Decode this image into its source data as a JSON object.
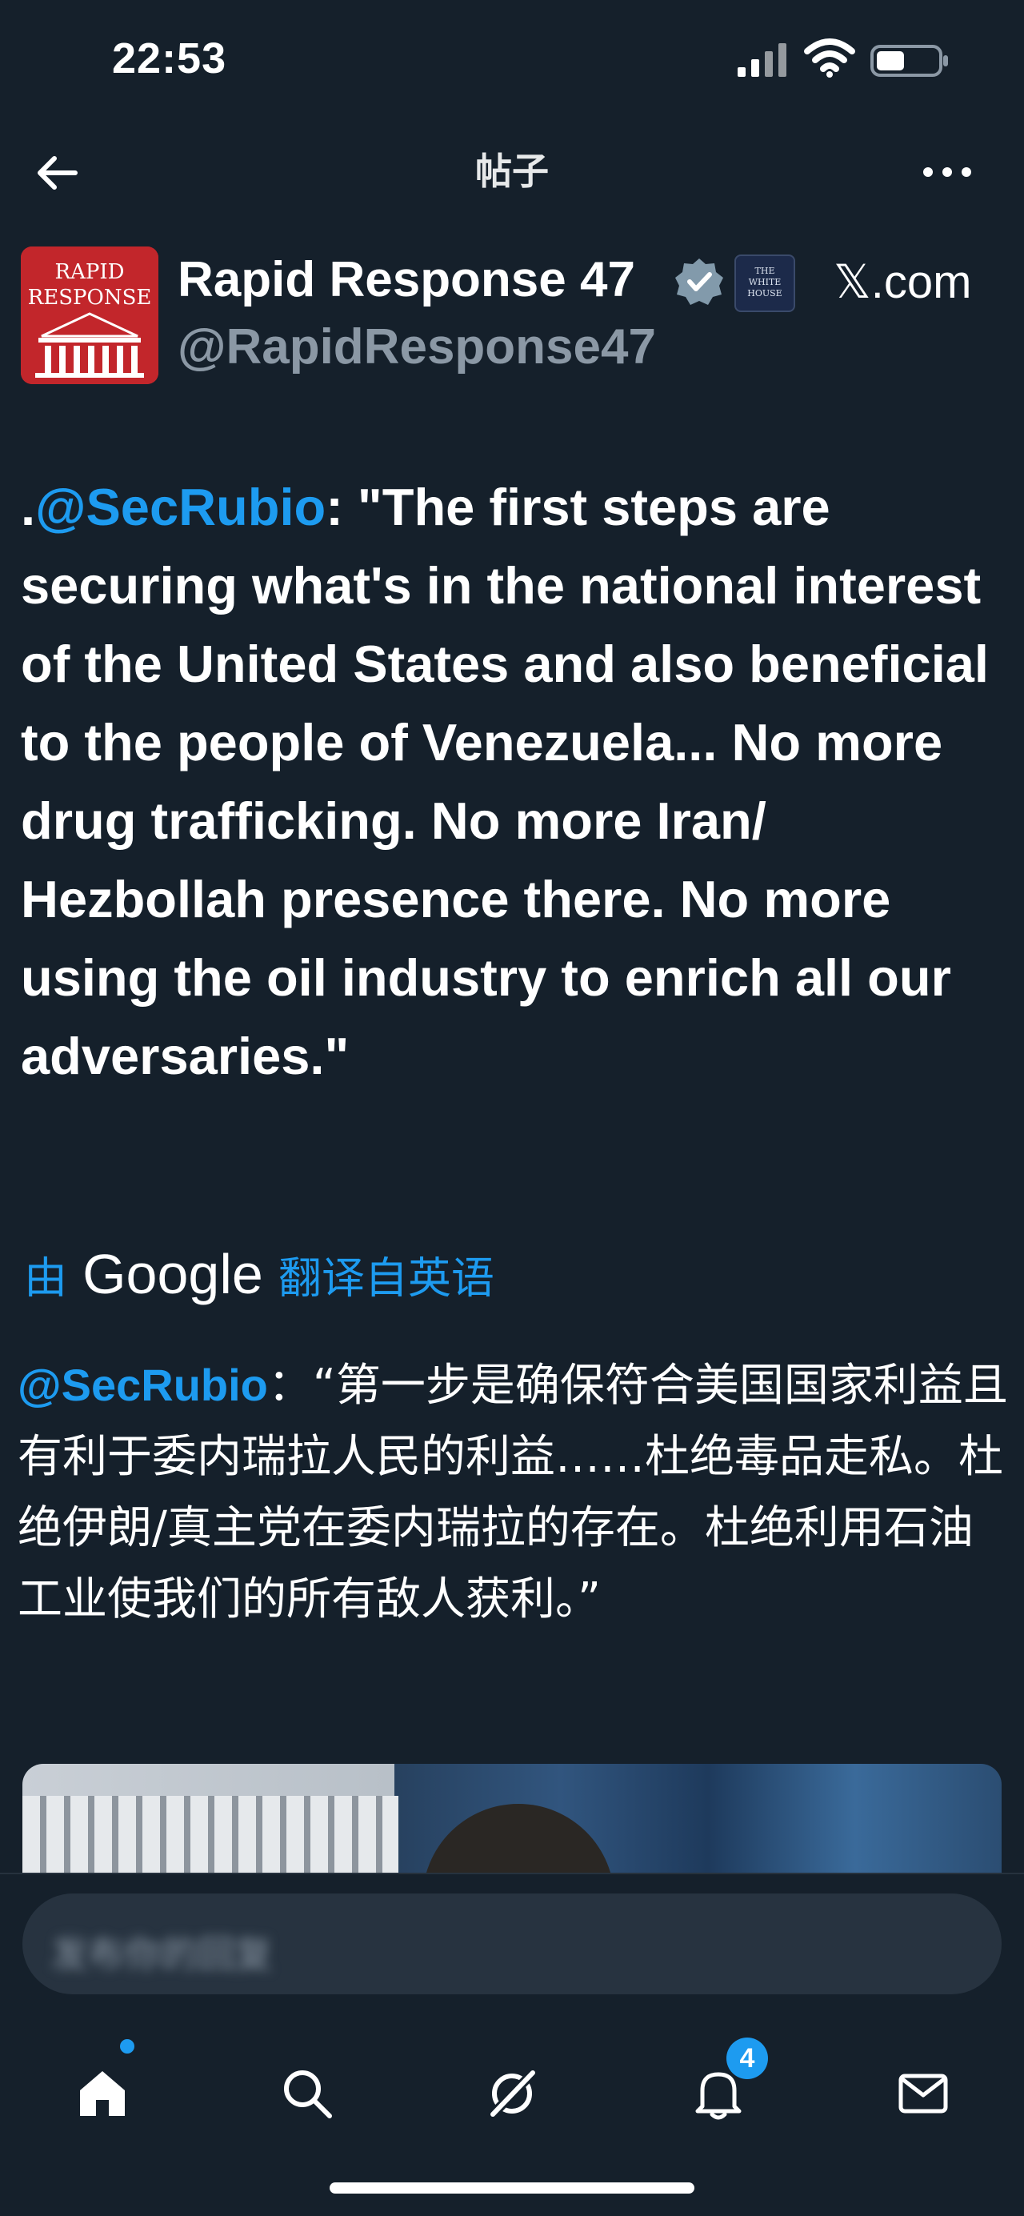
{
  "status_bar": {
    "time": "22:53"
  },
  "header": {
    "title": "帖子"
  },
  "post": {
    "author": {
      "avatar_line1": "RAPID",
      "avatar_line2": "RESPONSE",
      "name": "Rapid Response 47",
      "handle": "@RapidResponse47",
      "affiliation_line1": "THE",
      "affiliation_line2": "WHITE",
      "affiliation_line3": "HOUSE",
      "source": "𝕏.com"
    },
    "text_prefix": ".",
    "mention": "@SecRubio",
    "text_body": ": \"The first steps are securing what's in the national interest of the United States and also beneficial to the people of Venezuela... No more drug trafficking. No more Iran/ Hezbollah presence there. No more using the oil industry to enrich all our adversaries.\"",
    "translation": {
      "by_label": "由",
      "provider": "Google",
      "link_label": "翻译自英语",
      "mention": "@SecRubio",
      "text": "：“第一步是确保符合美国国家利益且有利于委内瑞拉人民的利益……杜绝毒品走私。杜绝伊朗/真主党在委内瑞拉的存在。杜绝利用石油工业使我们的所有敌人获利。”"
    }
  },
  "reply": {
    "placeholder": "发布你的回复"
  },
  "tab_bar": {
    "notifications_count": "4"
  },
  "colors": {
    "background": "#15202b",
    "accent": "#1d9bf0",
    "secondary_text": "#8b98a5"
  }
}
